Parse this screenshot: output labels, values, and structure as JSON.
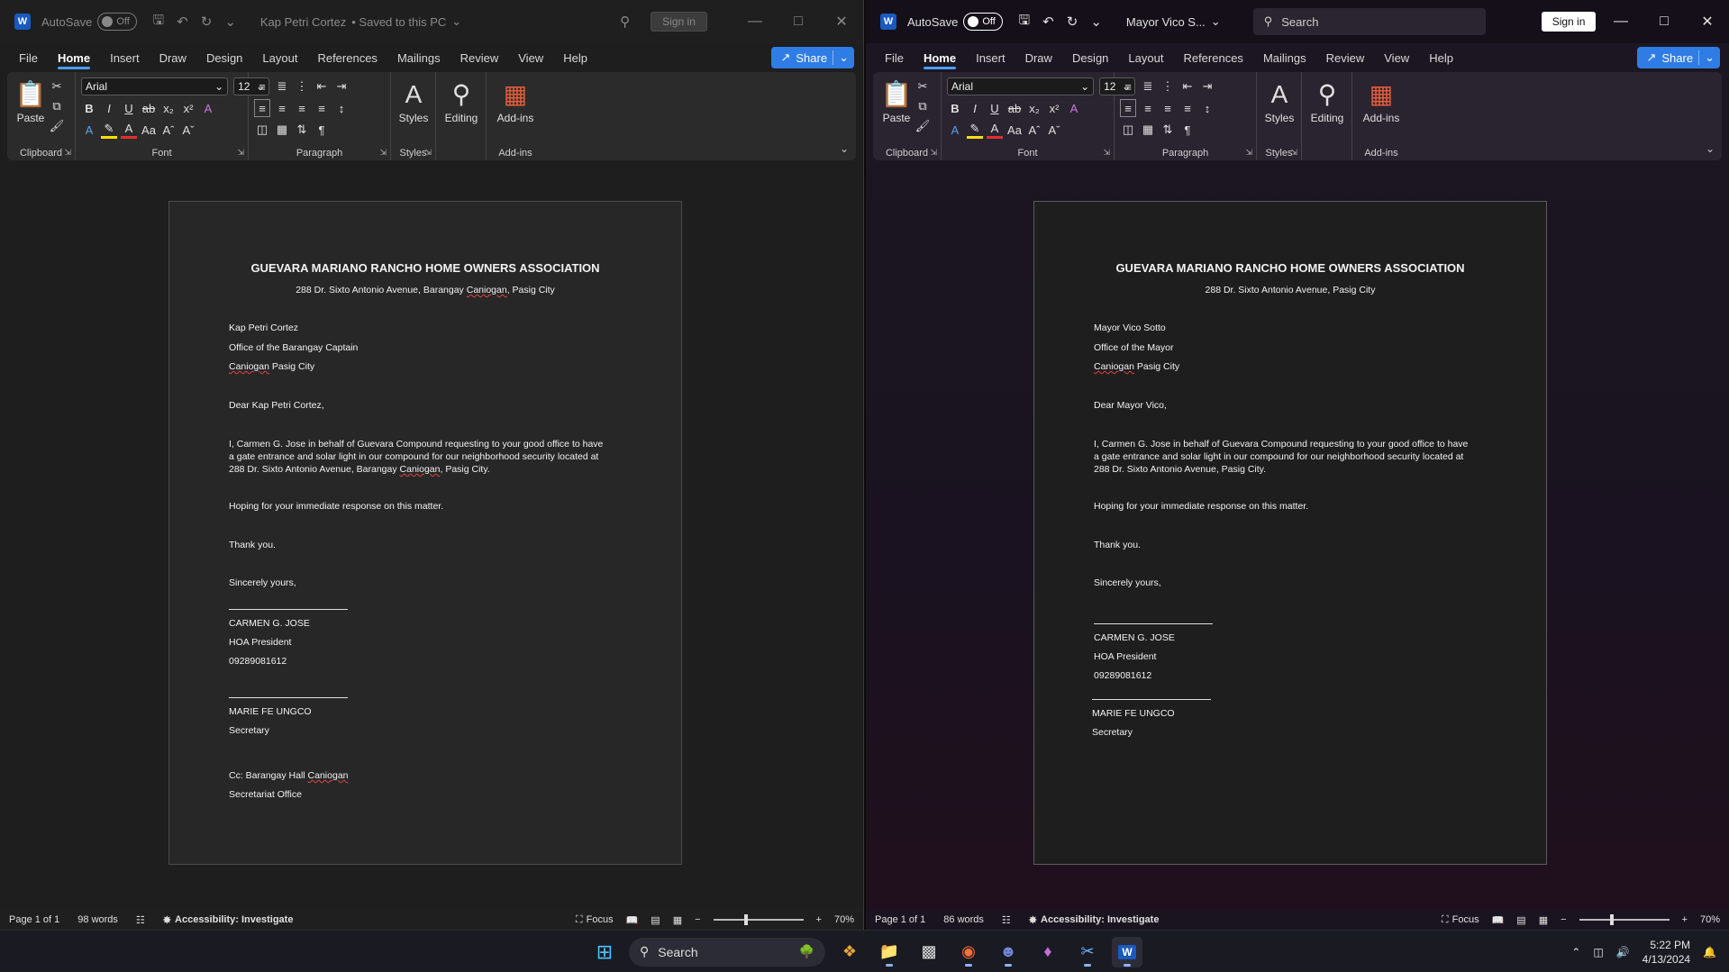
{
  "left_window": {
    "autosave_label": "AutoSave",
    "autosave_state": "Off",
    "doc_title": "Kap Petri Cortez",
    "save_status": "• Saved to this PC",
    "sign_in": "Sign in",
    "menu": [
      "File",
      "Home",
      "Insert",
      "Draw",
      "Design",
      "Layout",
      "References",
      "Mailings",
      "Review",
      "View",
      "Help"
    ],
    "share": "Share",
    "ribbon": {
      "font_name": "Arial",
      "font_size": "12",
      "paste": "Paste",
      "styles": "Styles",
      "editing": "Editing",
      "addins": "Add-ins",
      "groups": [
        "Clipboard",
        "Font",
        "Paragraph",
        "Styles",
        "Add-ins"
      ]
    },
    "document": {
      "title": "GUEVARA MARIANO RANCHO HOME OWNERS ASSOCIATION",
      "address_a": "288 Dr. Sixto Antonio Avenue, Barangay ",
      "address_b": "Caniogan",
      "address_c": ", Pasig City",
      "recipient_name": "Kap Petri Cortez",
      "recipient_office": "Office of the Barangay Captain",
      "recipient_city_a": "Caniogan",
      "recipient_city_b": " Pasig City",
      "salutation": "Dear Kap Petri Cortez,",
      "body_a": "I, Carmen G. Jose in behalf of Guevara Compound requesting to your good office to have a gate entrance and solar light in our compound for our neighborhood security located at 288 Dr. Sixto Antonio Avenue, Barangay ",
      "body_b": "Caniogan",
      "body_c": ", Pasig City.",
      "hoping": "Hoping for your immediate response on this matter.",
      "thanks": "Thank you.",
      "closing": "Sincerely yours,",
      "signer1_name": "CARMEN G. JOSE",
      "signer1_title": "HOA President",
      "signer1_phone": "09289081612",
      "signer2_name": "MARIE FE UNGCO",
      "signer2_title": "Secretary",
      "cc_a": "Cc: Barangay Hall ",
      "cc_b": "Caniogan",
      "cc_office": "Secretariat Office"
    },
    "status": {
      "page": "Page 1 of 1",
      "words": "98 words",
      "accessibility": "Accessibility: Investigate",
      "focus": "Focus",
      "zoom": "70%"
    }
  },
  "right_window": {
    "autosave_label": "AutoSave",
    "autosave_state": "Off",
    "doc_title": "Mayor Vico S...",
    "search": "Search",
    "sign_in": "Sign in",
    "menu": [
      "File",
      "Home",
      "Insert",
      "Draw",
      "Design",
      "Layout",
      "References",
      "Mailings",
      "Review",
      "View",
      "Help"
    ],
    "share": "Share",
    "ribbon": {
      "font_name": "Arial",
      "font_size": "12",
      "paste": "Paste",
      "styles": "Styles",
      "editing": "Editing",
      "addins": "Add-ins",
      "groups": [
        "Clipboard",
        "Font",
        "Paragraph",
        "Styles",
        "Add-ins"
      ]
    },
    "document": {
      "title": "GUEVARA MARIANO RANCHO HOME OWNERS ASSOCIATION",
      "address": "288 Dr. Sixto Antonio Avenue, Pasig City",
      "recipient_name": "Mayor Vico Sotto",
      "recipient_office": "Office of the Mayor",
      "recipient_city_a": "Caniogan",
      "recipient_city_b": " Pasig City",
      "salutation": "Dear Mayor Vico,",
      "body": "I, Carmen G. Jose in behalf of Guevara Compound requesting to your good office to have a gate entrance and solar light in our compound for our neighborhood security located at 288 Dr. Sixto Antonio Avenue, Pasig City.",
      "hoping": "Hoping for your immediate response on this matter.",
      "thanks": "Thank you.",
      "closing": "Sincerely yours,",
      "signer1_name": "CARMEN G. JOSE",
      "signer1_title": "HOA President",
      "signer1_phone": "09289081612",
      "signer2_name": "MARIE FE UNGCO",
      "signer2_title": "Secretary"
    },
    "status": {
      "page": "Page 1 of 1",
      "words": "86 words",
      "accessibility": "Accessibility: Investigate",
      "focus": "Focus",
      "zoom": "70%"
    }
  },
  "taskbar": {
    "search": "Search",
    "time": "5:22 PM",
    "date": "4/13/2024",
    "apps": [
      "start-icon",
      "copilot-icon",
      "file-explorer-icon",
      "terminal-icon",
      "firefox-icon",
      "discord-icon",
      "app-icon",
      "snipping-icon",
      "word-icon"
    ]
  },
  "colors": {
    "accent": "#2f7ce5",
    "word_blue": "#185abd",
    "spell_error": "#e04545"
  }
}
